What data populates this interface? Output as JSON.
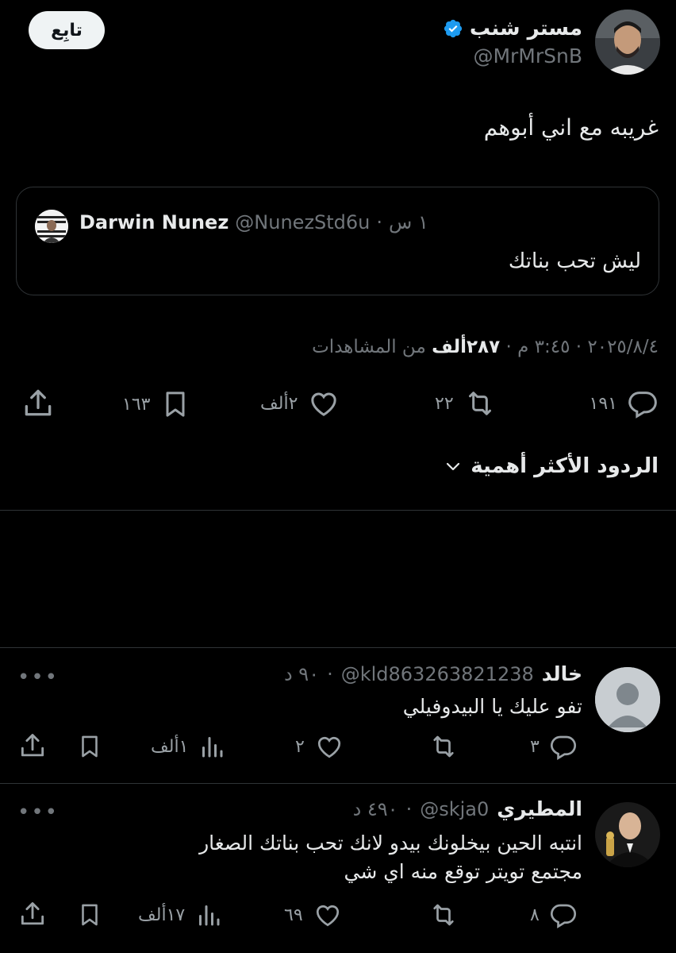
{
  "author": {
    "name": "مستر شنب",
    "handle": "@MrMrSnB",
    "verified": true,
    "verified_color": "#1d9bf0"
  },
  "follow_label": "تابِع",
  "tweet": {
    "text": "غريبه مع اني أبوهم"
  },
  "quote": {
    "name": "Darwin Nunez",
    "handle": "@NunezStd6u",
    "time": "١ س",
    "text": "ليش تحب بناتك"
  },
  "meta": {
    "date": "٢٠٢٥/٨/٤",
    "time": "٣:٤٥ م",
    "views_count": "٢٨٧ألف",
    "views_label": "من المشاهدات"
  },
  "actions": {
    "replies": "١٩١",
    "reposts": "٢٢",
    "likes": "٢ألف",
    "bookmarks": "١٦٣"
  },
  "top_replies_label": "الردود الأكثر أهمية",
  "replies": [
    {
      "name": "خالد",
      "handle": "@kld863263821238",
      "time": "٩٠ د",
      "text": "تفو عليك يا البيدوفيلي",
      "reply_count": "٣",
      "repost_count": "",
      "like_count": "٢",
      "views": "١ألف"
    },
    {
      "name": "المطيري",
      "handle": "@skja0",
      "time": "٤٩٠ د",
      "text_line1": "انتبه الحين بيخلونك بيدو لانك تحب بناتك الصغار",
      "text_line2": "مجتمع تويتر توقع منه اي شي",
      "reply_count": "٨",
      "repost_count": "",
      "like_count": "٦٩",
      "views": "١٧ألف"
    }
  ],
  "dots": "•••",
  "separator": "·",
  "colors": {
    "background": "#000000",
    "text": "#e7e9ea",
    "muted": "#71767b",
    "border": "#2f3336",
    "verified": "#1d9bf0"
  }
}
